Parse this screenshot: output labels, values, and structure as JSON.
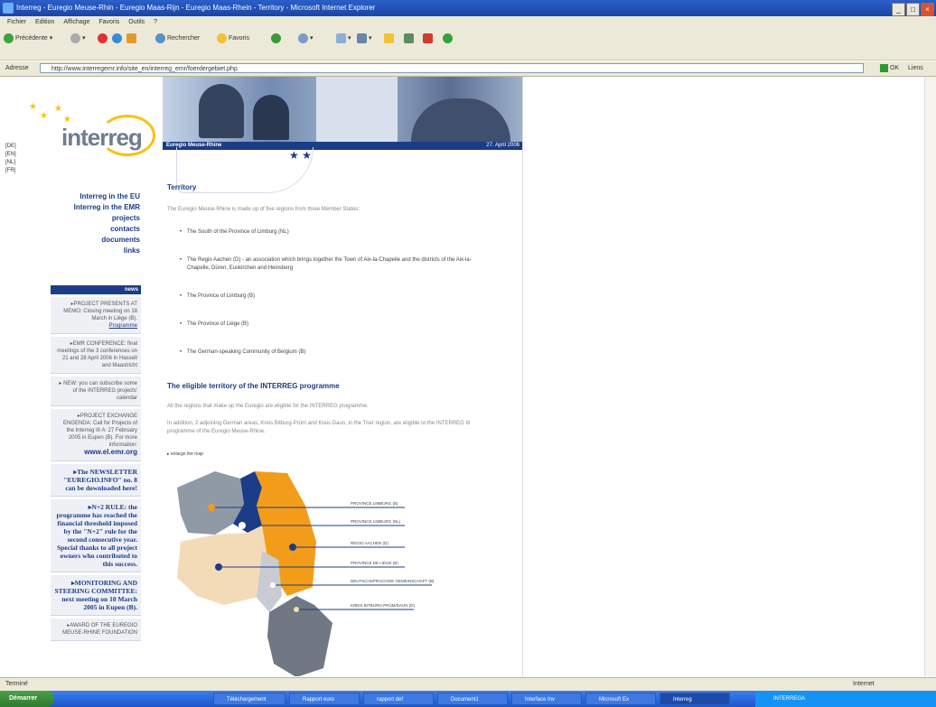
{
  "window": {
    "title": "Interreg - Euregio Meuse-Rhin - Euregio Maas-Rijn - Euregio Maas-Rhein - Territory - Microsoft Internet Explorer",
    "controls": [
      "_",
      "□",
      "×"
    ]
  },
  "menubar": [
    "Fichier",
    "Edition",
    "Affichage",
    "Favoris",
    "Outils",
    "?"
  ],
  "toolbar": {
    "back": "Précédente",
    "search": "Rechercher",
    "favorites": "Favoris"
  },
  "addressbar": {
    "label": "Adresse",
    "url": "http://www.interregemr.info/site_en/interreg_emr/foerdergebiet.php",
    "go": "OK",
    "links": "Liens"
  },
  "site": {
    "logo_text": "interreg",
    "languages": [
      "[DE]",
      "[EN]",
      "[NL]",
      "[FR]"
    ],
    "nav": [
      "Interreg in the EU",
      "Interreg in the EMR",
      "projects",
      "contacts",
      "documents",
      "links"
    ],
    "banner_region": "Euregio Meuse-Rhine",
    "banner_date": "27. April 2006",
    "news_header": "news",
    "news": [
      {
        "text": "▸PROJECT PRESENTS AT MEMO: Closing meeting on 18 March in Liège (B).",
        "link": "Programme"
      },
      {
        "text": "▸EMR CONFERENCE: final meetings of the 3 conferences on 21 and 28 April 2006 in Hasselt and Maastricht"
      },
      {
        "text": "▸ NEW: you can subscribe some of the INTERREG projects' calendar"
      },
      {
        "text": "▸PROJECT EXCHANGE ENGENDA: Call for Projects of the Interreg III A: 27 February 2005 in Eupen (B). For more information:",
        "link": "www.el.emr.org"
      },
      {
        "text": "▸The NEWSLETTER \"EUREGIO.INFO\" no. 8 can be downloaded here!",
        "big": true
      },
      {
        "text": "▸N+2 RULE: the programme has reached the financial threshold imposed by the \"N+2\" rule for the second consecutive year. Special thanks to all project owners who contributed to this success.",
        "big": true
      },
      {
        "text": "▸MONITORING AND STEERING COMMITTEE: next meeting on 10 March 2005 in Eupen (B).",
        "big": true
      },
      {
        "text": "▸AWARD OF THE EUREGIO MEUSE-RHINE FOUNDATION"
      }
    ],
    "main": {
      "title": "Territory",
      "intro": "The Euregio Meuse-Rhine is made up of five regions from three Member States:",
      "regions": [
        "The South of the Province of Limburg (NL)",
        "The Regio Aachen (D) - an association which brings together the Town of Aix-la-Chapelle and the districts of the Aix-la-Chapelle, Düren, Euskirchen and Heinsberg",
        "The Province of Limburg (B)",
        "The Province of Liège (B)",
        "The German-speaking Community of Belgium (B)"
      ],
      "subtitle": "The eligible territory of the INTERREG programme",
      "para1": "All the regions that make up the Euregio are eligible for the INTERREG programme.",
      "para2": "In addition, 2 adjoining German areas, Kreis Bitburg-Prüm and Kreis Daun, in the Trier region, are eligible to the INTERREG III programme of the Euregio Meuse-Rhine.",
      "map_caption": "▸ enlarge the map",
      "map_labels": [
        "PROVINCE LIMBURG (B)",
        "PROVINCE LIMBURG (NL)",
        "REGIO AACHEN (D)",
        "PROVINCE DE LIÈGE (B)",
        "DEUTSCHSPRACHIGE GEMEINSCHAFT (B)",
        "KREIS BITBURG-PRÜM/DAUN (D)"
      ]
    }
  },
  "statusbar": {
    "left": "Terminé",
    "right": "Internet"
  },
  "taskbar": {
    "start": "Démarrer",
    "tasks": [
      "Téléchargement",
      "Rapport euro",
      "rapport def",
      "Document1",
      "Interface Inv",
      "Microsoft Ex",
      "Interreg"
    ],
    "tray": "INTERREGA"
  },
  "colors": {
    "brand": "#1b3c86",
    "orange": "#f39c1a",
    "grey_region": "#8f9aa6",
    "cream_region": "#f4dbb8"
  }
}
